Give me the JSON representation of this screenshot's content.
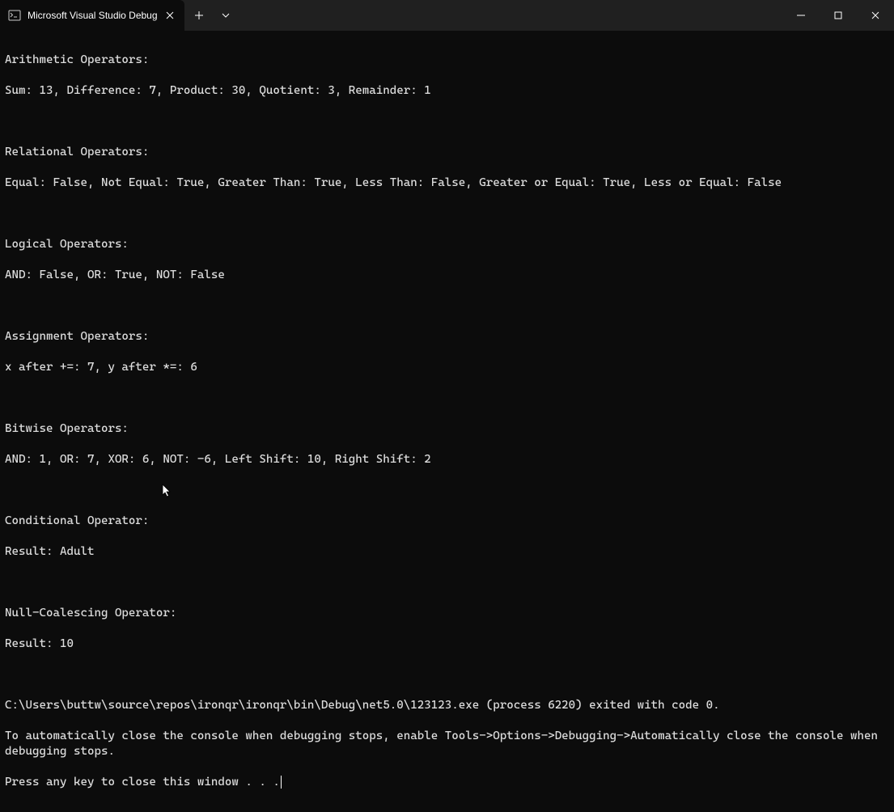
{
  "titlebar": {
    "tab_title": "Microsoft Visual Studio Debug"
  },
  "output": {
    "l01": "Arithmetic Operators:",
    "l02": "Sum: 13, Difference: 7, Product: 30, Quotient: 3, Remainder: 1",
    "l03": "",
    "l04": "Relational Operators:",
    "l05": "Equal: False, Not Equal: True, Greater Than: True, Less Than: False, Greater or Equal: True, Less or Equal: False",
    "l06": "",
    "l07": "Logical Operators:",
    "l08": "AND: False, OR: True, NOT: False",
    "l09": "",
    "l10": "Assignment Operators:",
    "l11": "x after +=: 7, y after *=: 6",
    "l12": "",
    "l13": "Bitwise Operators:",
    "l14": "AND: 1, OR: 7, XOR: 6, NOT: -6, Left Shift: 10, Right Shift: 2",
    "l15": "",
    "l16": "Conditional Operator:",
    "l17": "Result: Adult",
    "l18": "",
    "l19": "Null-Coalescing Operator:",
    "l20": "Result: 10",
    "l21": "",
    "l22": "C:\\Users\\buttw\\source\\repos\\ironqr\\ironqr\\bin\\Debug\\net5.0\\123123.exe (process 6220) exited with code 0.",
    "l23": "To automatically close the console when debugging stops, enable Tools->Options->Debugging->Automatically close the console when debugging stops.",
    "l24": "Press any key to close this window . . ."
  }
}
